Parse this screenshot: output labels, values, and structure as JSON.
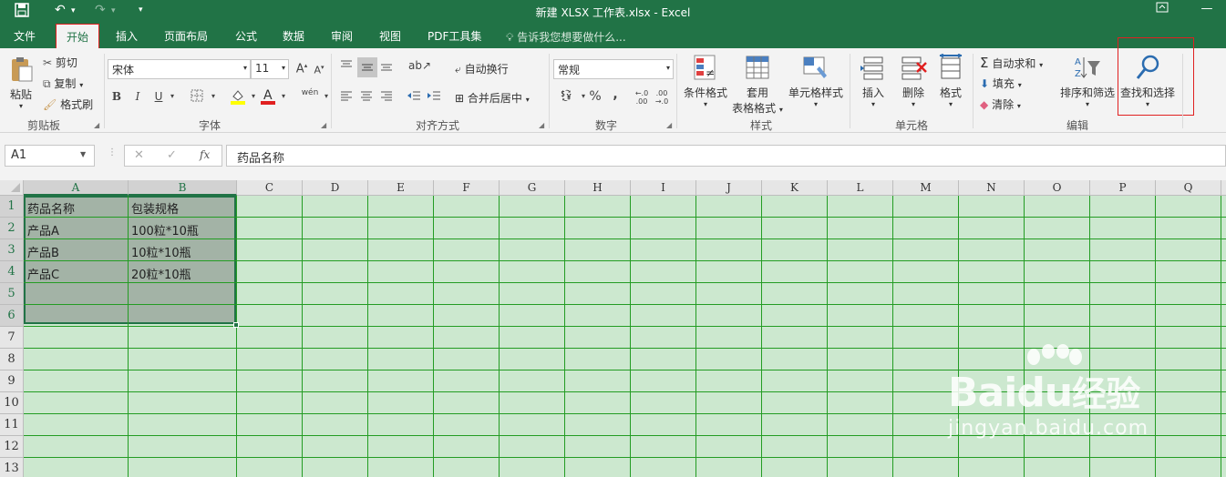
{
  "window": {
    "title": "新建 XLSX 工作表.xlsx - Excel"
  },
  "ribbon_tabs": {
    "file": "文件",
    "home": "开始",
    "insert": "插入",
    "page_layout": "页面布局",
    "formulas": "公式",
    "data": "数据",
    "review": "审阅",
    "view": "视图",
    "pdf": "PDF工具集",
    "tell_me": "告诉我您想要做什么..."
  },
  "clipboard": {
    "paste": "粘贴",
    "cut": "剪切",
    "copy": "复制",
    "format_painter": "格式刷",
    "label": "剪贴板"
  },
  "font": {
    "name": "宋体",
    "size": "11",
    "phonetic": "wén",
    "label": "字体"
  },
  "alignment": {
    "wrap_text": "自动换行",
    "merge_center": "合并后居中",
    "label": "对齐方式"
  },
  "number": {
    "format": "常规",
    "label": "数字"
  },
  "styles": {
    "conditional": "条件格式",
    "table_format_1": "套用",
    "table_format_2": "表格格式",
    "cell_styles": "单元格样式",
    "label": "样式"
  },
  "cells": {
    "insert": "插入",
    "delete": "删除",
    "format": "格式",
    "label": "单元格"
  },
  "editing": {
    "autosum": "自动求和",
    "fill": "填充",
    "clear": "清除",
    "sort_filter": "排序和筛选",
    "find_select": "查找和选择",
    "label": "编辑"
  },
  "formula_bar": {
    "name_box": "A1",
    "content": "药品名称"
  },
  "columns": [
    "A",
    "B",
    "C",
    "D",
    "E",
    "F",
    "G",
    "H",
    "I",
    "J",
    "K",
    "L",
    "M",
    "N",
    "O",
    "P",
    "Q"
  ],
  "rows": [
    "1",
    "2",
    "3",
    "4",
    "5",
    "6",
    "7",
    "8",
    "9",
    "10",
    "11",
    "12",
    "13"
  ],
  "cells_data": {
    "A1": "药品名称",
    "B1": "包装规格",
    "A2": "产品A",
    "B2": "100粒*10瓶",
    "A3": "产品B",
    "B3": "10粒*10瓶",
    "A4": "产品C",
    "B4": "20粒*10瓶"
  },
  "watermark": {
    "brand": "Bai",
    "brand2": "du",
    "cn": "经验",
    "url": "jingyan.baidu.com"
  },
  "colors": {
    "excel_green": "#217346",
    "grid_bg": "#cce8cf",
    "grid_line": "#239c23",
    "highlight_box": "#e02020"
  }
}
